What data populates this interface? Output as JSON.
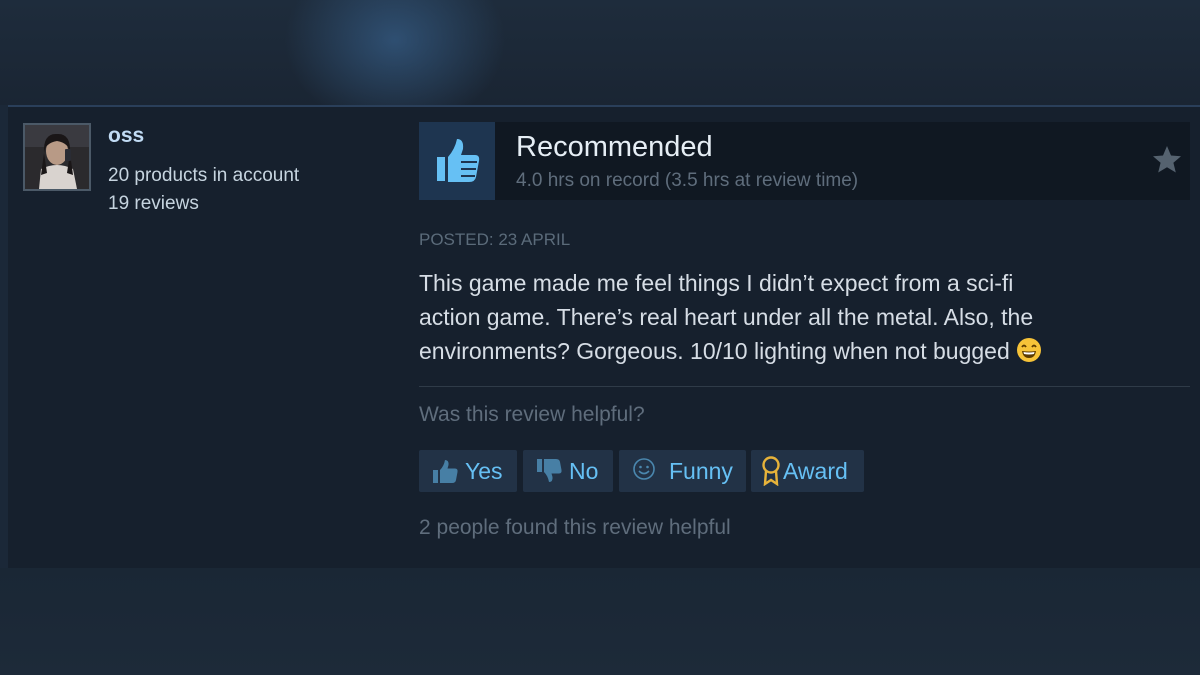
{
  "author": {
    "name": "oss",
    "products": "20 products in account",
    "reviews": "19 reviews"
  },
  "vote": {
    "title": "Recommended",
    "hours": "4.0 hrs on record (3.5 hrs at review time)"
  },
  "review": {
    "posted": "POSTED: 23 APRIL",
    "lines": [
      "This game made me feel things I didn’t expect from a sci-fi",
      "action game. There’s real heart under all the metal. Also, the",
      "environments? Gorgeous. 10/10 lighting when not bugged"
    ]
  },
  "helpful": {
    "question": "Was this review helpful?",
    "yes_label": "Yes",
    "no_label": "No",
    "funny_label": "Funny",
    "award_label": "Award",
    "count_text": "2 people found this review helpful"
  },
  "icons": {
    "thumb": "thumbs-up-icon",
    "star": "star-icon",
    "emoji": "grinning-face-icon",
    "yes": "thumbs-up-icon",
    "no": "thumbs-down-icon",
    "funny": "smiley-icon",
    "award": "award-ribbon-icon"
  },
  "colors": {
    "background": "#1b2838",
    "card": "#16202d",
    "accent": "#66c0f4",
    "author_name": "#c1dbf4",
    "button": "#223246"
  }
}
